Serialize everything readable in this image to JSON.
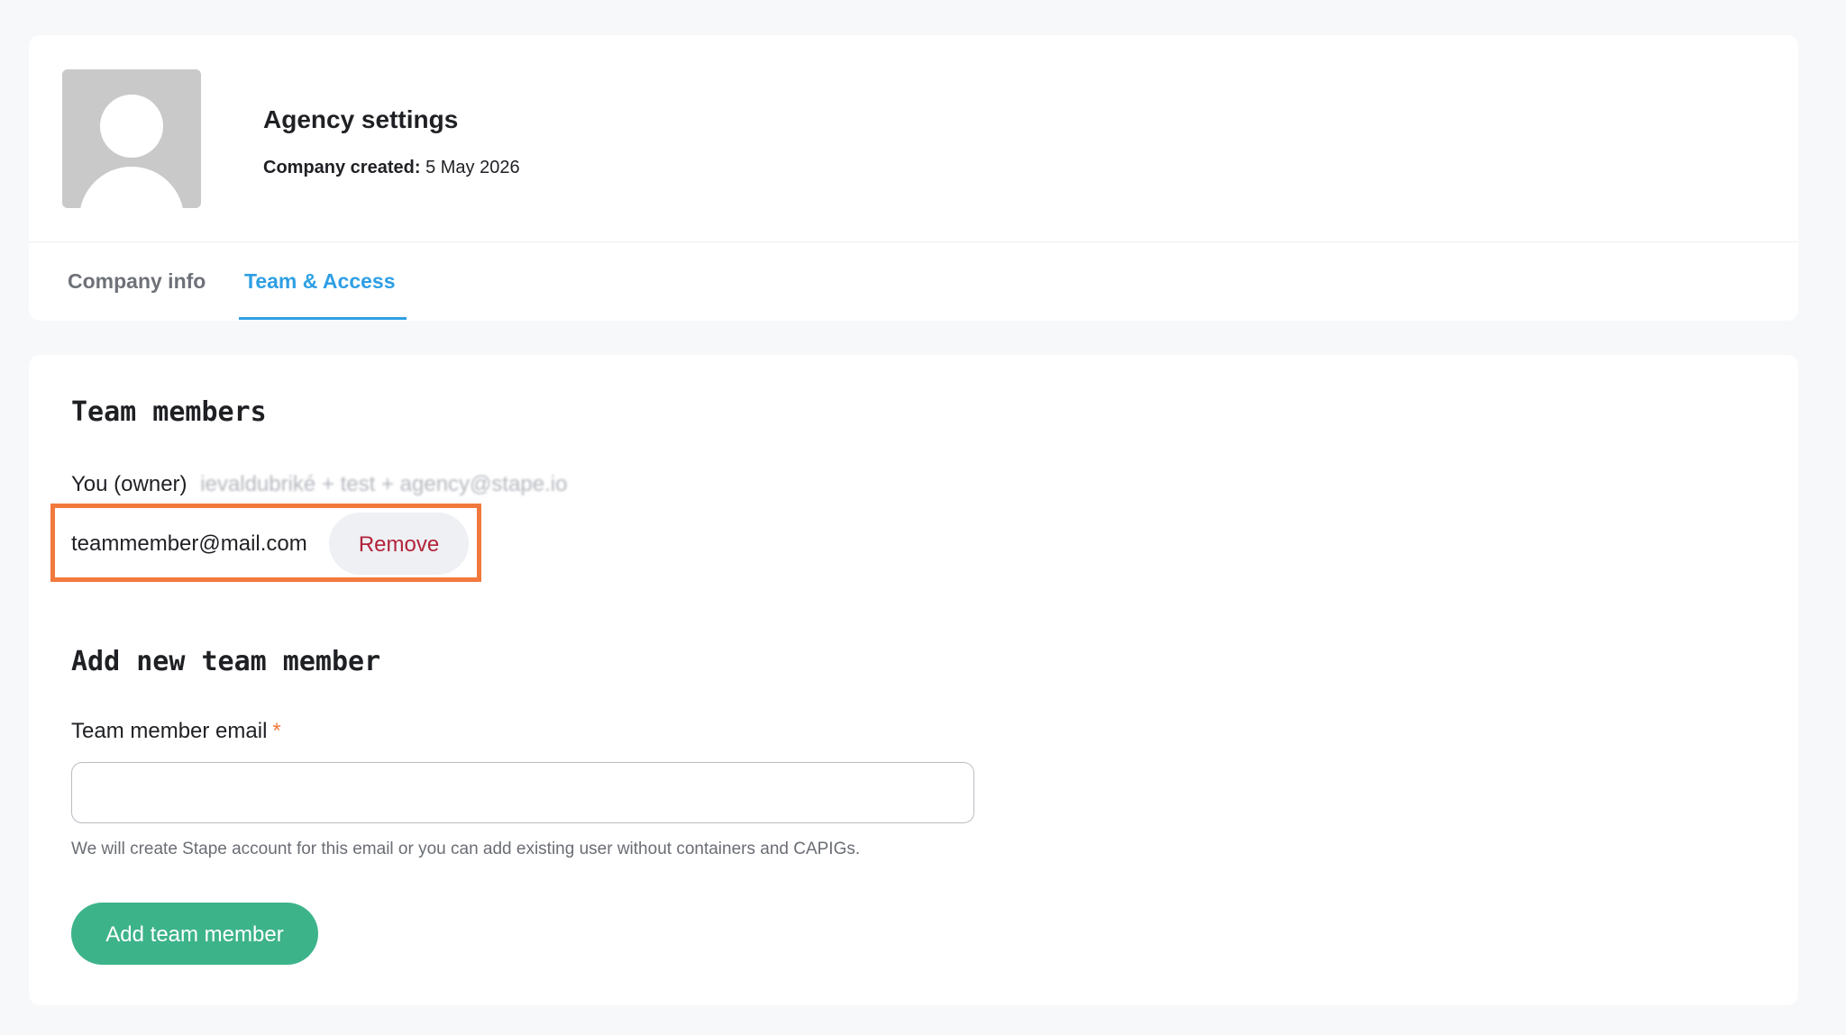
{
  "header": {
    "title": "Agency settings",
    "company_created_label": "Company created:",
    "company_created_value": "5 May 2026",
    "avatar_icon": "user-placeholder-icon"
  },
  "tabs": [
    {
      "label": "Company info",
      "active": false
    },
    {
      "label": "Team & Access",
      "active": true
    }
  ],
  "team": {
    "title": "Team members",
    "owner_label": "You (owner)",
    "owner_email": "ievaldubriké + test + agency@stape.io",
    "members": [
      {
        "email": "teammember@mail.com",
        "remove_label": "Remove"
      }
    ]
  },
  "add_member": {
    "title": "Add new team member",
    "email_label": "Team member email",
    "required_mark": "*",
    "email_value": "",
    "hint": "We will create Stape account for this email or you can add existing user without containers and CAPIGs.",
    "submit_label": "Add team member"
  },
  "colors": {
    "accent_blue": "#2f9fe4",
    "primary_green": "#3db38a",
    "danger_red": "#b3233b",
    "highlight_orange": "#f2793d"
  }
}
